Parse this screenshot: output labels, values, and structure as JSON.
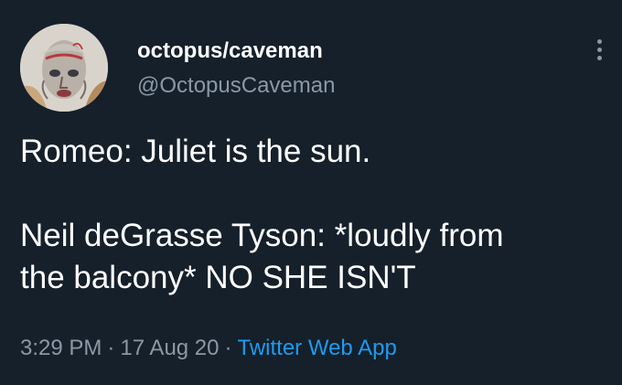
{
  "author": {
    "display_name": "octopus/caveman",
    "handle": "@OctopusCaveman",
    "avatar_icon": "painted-face-avatar"
  },
  "tweet": {
    "lines": [
      "Romeo: Juliet is the sun.",
      "",
      "Neil deGrasse Tyson: *loudly from",
      "the balcony* NO SHE ISN'T"
    ]
  },
  "meta": {
    "time": "3:29 PM",
    "date": "17 Aug 20",
    "separator": "·",
    "source": "Twitter Web App"
  },
  "colors": {
    "background": "#15202b",
    "text": "#ffffff",
    "secondary": "#8b98a5",
    "link": "#1d9bf0"
  }
}
